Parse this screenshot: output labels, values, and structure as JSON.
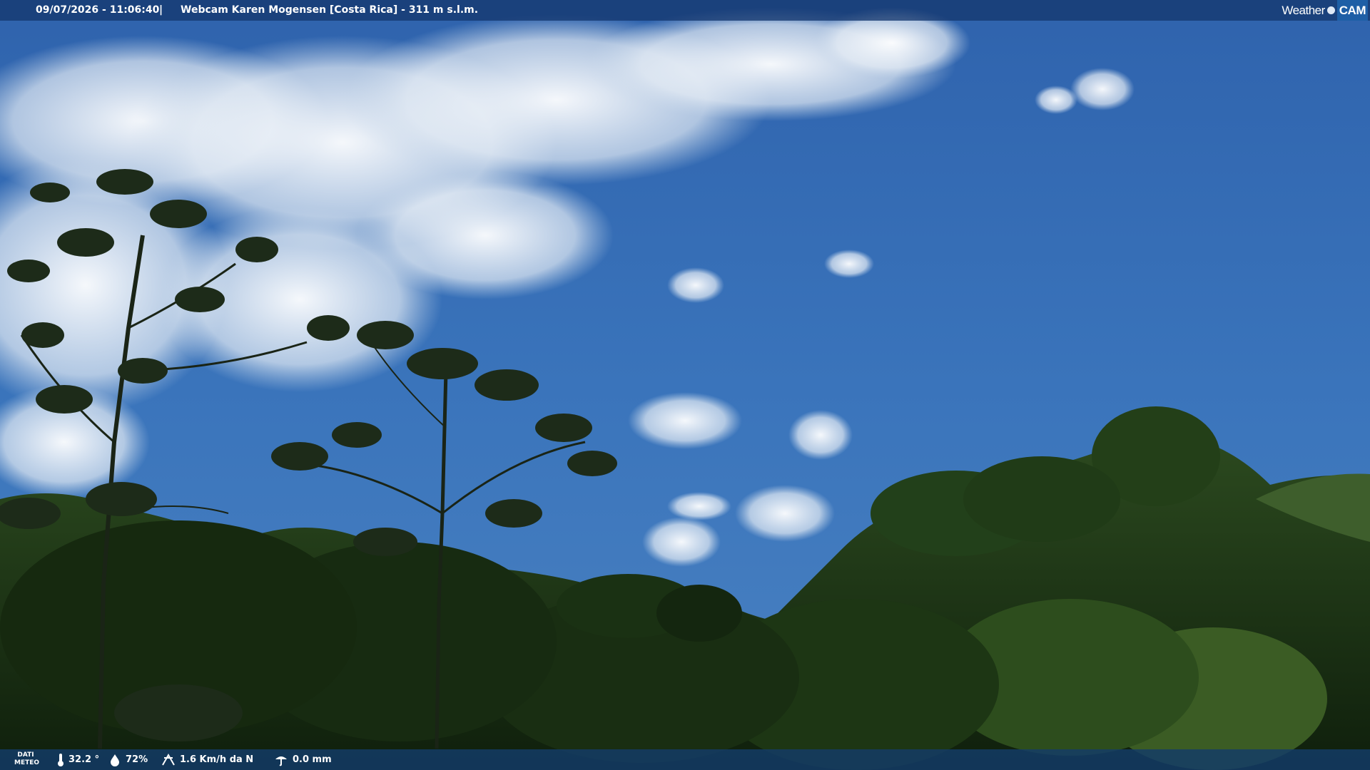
{
  "header": {
    "datetime": "09/07/2026 - 11:06:40",
    "separator": "|",
    "camera_title": "Webcam Karen Mogensen [Costa Rica]  - 311 m s.l.m.",
    "logo_weather": "Weather",
    "logo_cam": "CAM"
  },
  "footer": {
    "section_label_line1": "DATI",
    "section_label_line2": "METEO",
    "temperature": "32.2 °",
    "humidity": "72%",
    "wind": "1.6 Km/h da N",
    "rain": "0.0 mm"
  },
  "icons": {
    "temperature": "thermometer-icon",
    "humidity": "humidity-drop-icon",
    "wind": "wind-icon",
    "rain": "rain-gauge-icon"
  },
  "colors": {
    "sky_top": "#3a6fb5",
    "sky_bottom": "#3f79bd",
    "foliage_dark": "#14270f",
    "foliage": "#2b4a1d",
    "bar": "#163d6c"
  }
}
